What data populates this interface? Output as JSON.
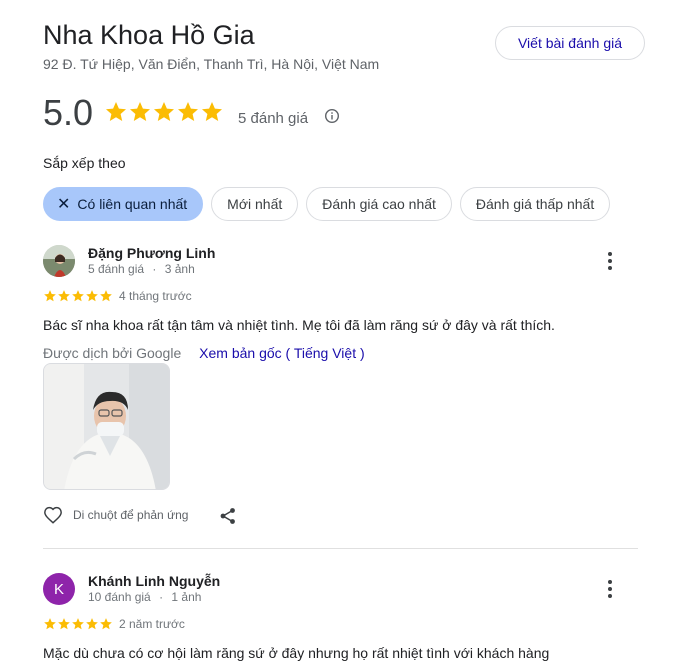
{
  "place": {
    "name": "Nha Khoa Hồ Gia",
    "address": "92 Đ. Tứ Hiệp, Văn Điển, Thanh Trì, Hà Nội, Việt Nam",
    "write_review_label": "Viết bài đánh giá",
    "rating": "5.0",
    "review_count": "5 đánh giá",
    "star_color": "#fbbc04"
  },
  "sort": {
    "label": "Sắp xếp theo",
    "chips": [
      {
        "label": "Có liên quan nhất",
        "active": true
      },
      {
        "label": "Mới nhất",
        "active": false
      },
      {
        "label": "Đánh giá cao nhất",
        "active": false
      },
      {
        "label": "Đánh giá thấp nhất",
        "active": false
      }
    ]
  },
  "reviews": [
    {
      "name": "Đặng Phương Linh",
      "review_count": "5 đánh giá",
      "separator": "·",
      "photo_count": "3 ảnh",
      "stars": 5,
      "time": "4 tháng trước",
      "text": "Bác sĩ nha khoa rất tận tâm và nhiệt tình. Mẹ tôi đã làm răng sứ ở đây và rất thích.",
      "translated_by": "Được dịch bởi Google",
      "see_original": "Xem bản gốc ( Tiếng Việt )",
      "react_label": "Di chuột để phản ứng"
    },
    {
      "name": "Khánh Linh Nguyễn",
      "avatar_letter": "K",
      "avatar_color": "#8e24aa",
      "review_count": "10 đánh giá",
      "separator": "·",
      "photo_count": "1 ảnh",
      "stars": 5,
      "time": "2 năm trước",
      "text": "Mặc dù chưa có cơ hội làm răng sứ ở đây nhưng họ rất nhiệt tình với khách hàng"
    }
  ]
}
